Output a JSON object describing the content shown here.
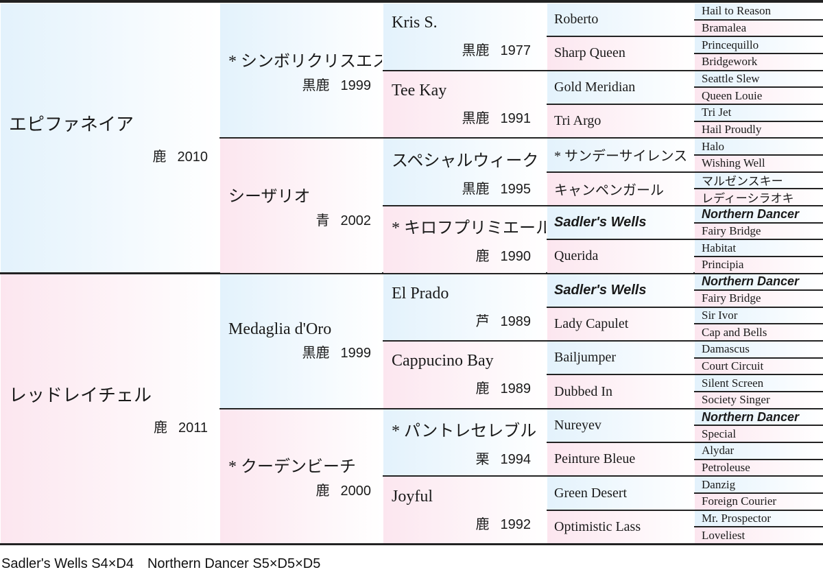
{
  "colors": {
    "sire_tint": "#e3f2fc",
    "dam_tint": "#fce6ef",
    "line": "#222222"
  },
  "gen1": [
    {
      "name": "エピファネイア",
      "color": "鹿",
      "year": "2010"
    },
    {
      "name": "レッドレイチェル",
      "color": "鹿",
      "year": "2011"
    }
  ],
  "gen2": [
    {
      "name": "* シンボリクリスエス",
      "color": "黒鹿",
      "year": "1999"
    },
    {
      "name": "シーザリオ",
      "color": "青",
      "year": "2002"
    },
    {
      "name": "Medaglia d'Oro",
      "color": "黒鹿",
      "year": "1999"
    },
    {
      "name": "* クーデンビーチ",
      "color": "鹿",
      "year": "2000"
    }
  ],
  "gen3": [
    {
      "name": "Kris S.",
      "color": "黒鹿",
      "year": "1977"
    },
    {
      "name": "Tee Kay",
      "color": "黒鹿",
      "year": "1991"
    },
    {
      "name": "スペシャルウィーク",
      "color": "黒鹿",
      "year": "1995"
    },
    {
      "name": "* キロフプリミエール",
      "color": "鹿",
      "year": "1990"
    },
    {
      "name": "El Prado",
      "color": "芦",
      "year": "1989"
    },
    {
      "name": "Cappucino Bay",
      "color": "鹿",
      "year": "1989"
    },
    {
      "name": "* パントレセレブル",
      "color": "栗",
      "year": "1994"
    },
    {
      "name": "Joyful",
      "color": "鹿",
      "year": "1992"
    }
  ],
  "gen4": [
    {
      "name": "Roberto"
    },
    {
      "name": "Sharp Queen"
    },
    {
      "name": "Gold Meridian"
    },
    {
      "name": "Tri Argo"
    },
    {
      "name": "* サンデーサイレンス"
    },
    {
      "name": "キャンペンガール"
    },
    {
      "name": "Sadler's Wells",
      "inbred": true
    },
    {
      "name": "Querida"
    },
    {
      "name": "Sadler's Wells",
      "inbred": true
    },
    {
      "name": "Lady Capulet"
    },
    {
      "name": "Bailjumper"
    },
    {
      "name": "Dubbed In"
    },
    {
      "name": "Nureyev"
    },
    {
      "name": "Peinture Bleue"
    },
    {
      "name": "Green Desert"
    },
    {
      "name": "Optimistic Lass"
    }
  ],
  "gen5": [
    {
      "name": "Hail to Reason"
    },
    {
      "name": "Bramalea"
    },
    {
      "name": "Princequillo"
    },
    {
      "name": "Bridgework"
    },
    {
      "name": "Seattle Slew"
    },
    {
      "name": "Queen Louie"
    },
    {
      "name": "Tri Jet"
    },
    {
      "name": "Hail Proudly"
    },
    {
      "name": "Halo"
    },
    {
      "name": "Wishing Well"
    },
    {
      "name": "マルゼンスキー"
    },
    {
      "name": "レディーシラオキ"
    },
    {
      "name": "Northern Dancer",
      "inbred": true
    },
    {
      "name": "Fairy Bridge"
    },
    {
      "name": "Habitat"
    },
    {
      "name": "Principia"
    },
    {
      "name": "Northern Dancer",
      "inbred": true
    },
    {
      "name": "Fairy Bridge"
    },
    {
      "name": "Sir Ivor"
    },
    {
      "name": "Cap and Bells"
    },
    {
      "name": "Damascus"
    },
    {
      "name": "Court Circuit"
    },
    {
      "name": "Silent Screen"
    },
    {
      "name": "Society Singer"
    },
    {
      "name": "Northern Dancer",
      "inbred": true
    },
    {
      "name": "Special"
    },
    {
      "name": "Alydar"
    },
    {
      "name": "Petroleuse"
    },
    {
      "name": "Danzig"
    },
    {
      "name": "Foreign Courier"
    },
    {
      "name": "Mr. Prospector"
    },
    {
      "name": "Loveliest"
    }
  ],
  "footer": "Sadler's Wells S4×D4　Northern Dancer S5×D5×D5"
}
